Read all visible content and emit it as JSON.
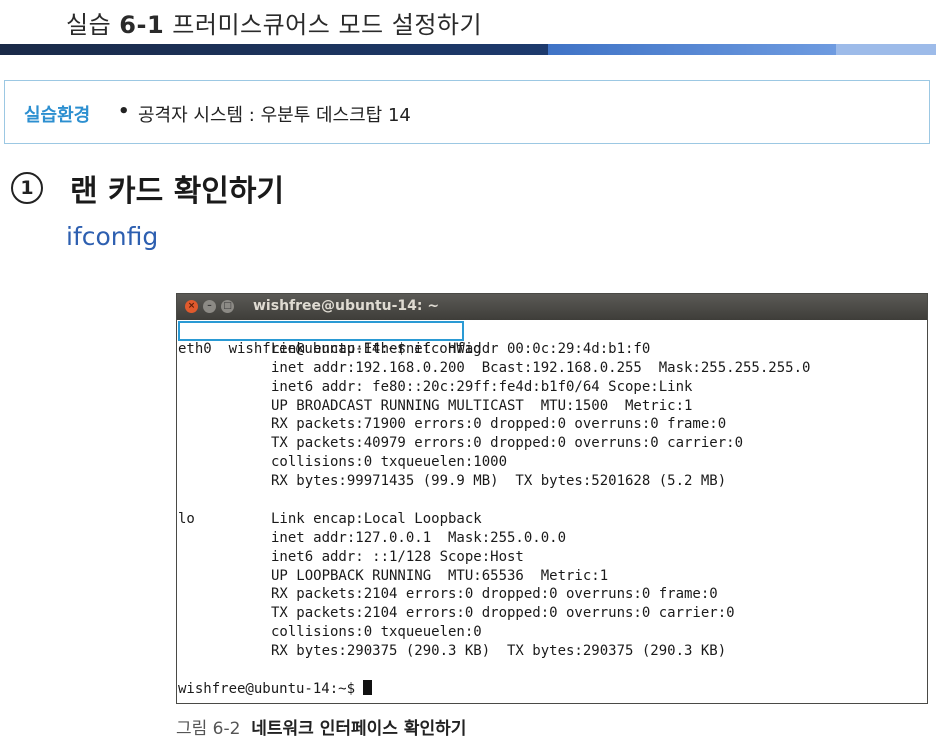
{
  "page": {
    "title_prefix": "실습 ",
    "title_number": "6-1",
    "title_text": " 프러미스큐어스 모드 설정하기"
  },
  "environment": {
    "label": "실습환경",
    "bullet": "•",
    "text": "공격자 시스템 : 우분투 데스크탑 14"
  },
  "step": {
    "number": "1",
    "title": "랜 카드 확인하기",
    "command": "ifconfig"
  },
  "terminal": {
    "window_title": "wishfree@ubuntu-14: ~",
    "prompt_command": "wishfree@ubuntu-14:~$ ifconfig",
    "interfaces": [
      {
        "name": "eth0",
        "lines": [
          "Link encap:Ethernet  HWaddr 00:0c:29:4d:b1:f0",
          "inet addr:192.168.0.200  Bcast:192.168.0.255  Mask:255.255.255.0",
          "inet6 addr: fe80::20c:29ff:fe4d:b1f0/64 Scope:Link",
          "UP BROADCAST RUNNING MULTICAST  MTU:1500  Metric:1",
          "RX packets:71900 errors:0 dropped:0 overruns:0 frame:0",
          "TX packets:40979 errors:0 dropped:0 overruns:0 carrier:0",
          "collisions:0 txqueuelen:1000",
          "RX bytes:99971435 (99.9 MB)  TX bytes:5201628 (5.2 MB)"
        ]
      },
      {
        "name": "lo",
        "lines": [
          "Link encap:Local Loopback",
          "inet addr:127.0.0.1  Mask:255.0.0.0",
          "inet6 addr: ::1/128 Scope:Host",
          "UP LOOPBACK RUNNING  MTU:65536  Metric:1",
          "RX packets:2104 errors:0 dropped:0 overruns:0 frame:0",
          "TX packets:2104 errors:0 dropped:0 overruns:0 carrier:0",
          "collisions:0 txqueuelen:0",
          "RX bytes:290375 (290.3 KB)  TX bytes:290375 (290.3 KB)"
        ]
      }
    ],
    "final_prompt": "wishfree@ubuntu-14:~$ "
  },
  "caption": {
    "figure_number": "그림 6-2",
    "figure_text": "네트워크 인터페이스 확인하기"
  },
  "colors": {
    "accent_blue": "#2c8fd0",
    "command_blue": "#2d5fb0",
    "highlight_box": "#2a9ad4",
    "terminal_titlebar": "#3e3d39",
    "close_button": "#e05a2d"
  },
  "icons": {
    "close": "close-icon",
    "minimize": "minimize-icon",
    "maximize": "maximize-icon"
  }
}
